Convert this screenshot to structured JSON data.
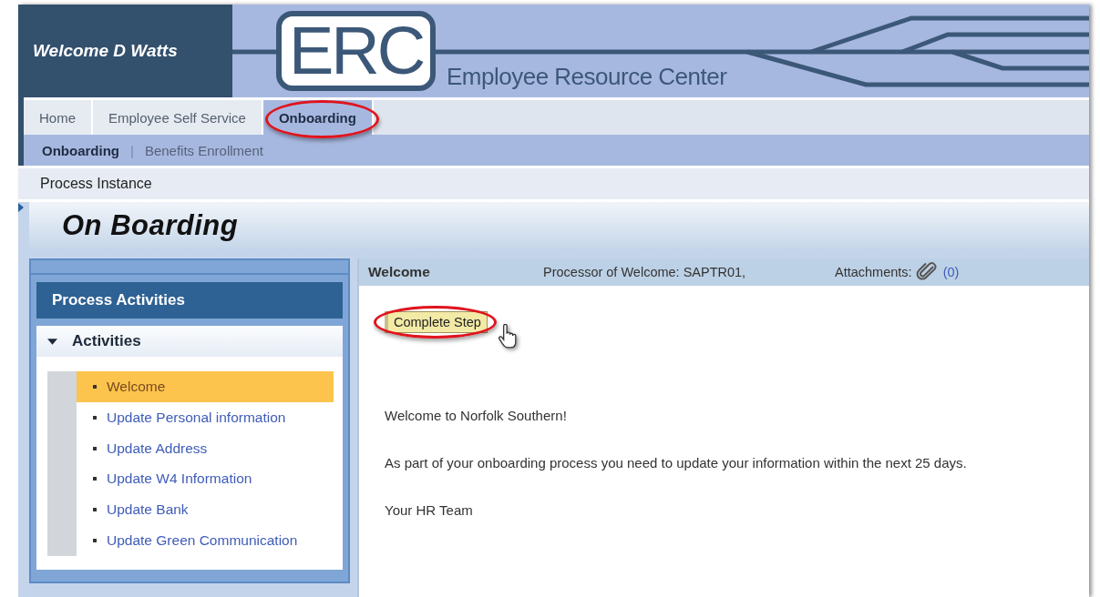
{
  "header": {
    "welcome": "Welcome D Watts",
    "logo": "ERC",
    "subtitle": "Employee Resource Center"
  },
  "tabs": [
    {
      "label": "Home",
      "selected": false,
      "highlighted": false
    },
    {
      "label": "Employee Self Service",
      "selected": false,
      "highlighted": false
    },
    {
      "label": "Onboarding",
      "selected": true,
      "highlighted": true
    }
  ],
  "subtabs": [
    {
      "label": "Onboarding",
      "selected": true
    },
    {
      "label": "Benefits Enrollment",
      "selected": false
    }
  ],
  "subtab_separator": "|",
  "breadcrumb": "Process Instance",
  "page_title": "On Boarding",
  "activities_panel": {
    "title": "Process Activities",
    "section": {
      "title": "Activities",
      "expanded": true
    },
    "items": [
      {
        "label": "Welcome",
        "selected": true
      },
      {
        "label": "Update Personal information",
        "selected": false
      },
      {
        "label": "Update Address",
        "selected": false
      },
      {
        "label": "Update W4 Information",
        "selected": false
      },
      {
        "label": "Update Bank",
        "selected": false
      },
      {
        "label": "Update Green Communication",
        "selected": false
      }
    ]
  },
  "step": {
    "name": "Welcome",
    "processor": "Processor of Welcome: SAPTR01,",
    "attachments_label": "Attachments:",
    "attachments_count": "(0)",
    "button": {
      "label": "Complete Step",
      "highlighted": true
    },
    "message": [
      "Welcome to Norfolk Southern!",
      "As part of your onboarding process you need to update your information within the next 25 days.",
      "Your HR Team"
    ]
  }
}
